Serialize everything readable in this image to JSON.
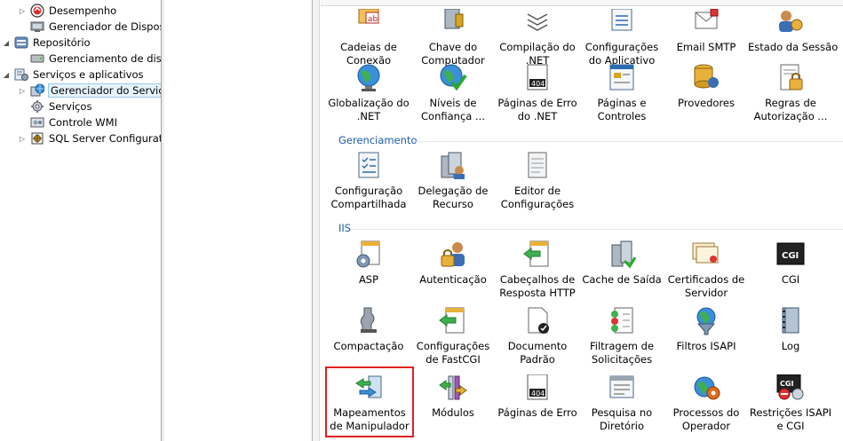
{
  "tree": {
    "items": [
      {
        "label": "Desempenho",
        "expander": "▷",
        "icon": "performance-icon"
      },
      {
        "label": "Gerenciador de Disposit",
        "expander": "",
        "icon": "device-manager-icon"
      },
      {
        "label": "Repositório",
        "expander": "◢",
        "icon": "storage-icon"
      },
      {
        "label": "Gerenciamento de disco",
        "expander": "",
        "icon": "disk-management-icon"
      },
      {
        "label": "Serviços e aplicativos",
        "expander": "◢",
        "icon": "services-apps-icon"
      },
      {
        "label": "Gerenciador do Serviços",
        "expander": "▷",
        "icon": "iis-manager-icon"
      },
      {
        "label": "Serviços",
        "expander": "",
        "icon": "services-icon"
      },
      {
        "label": "Controle WMI",
        "expander": "",
        "icon": "wmi-icon"
      },
      {
        "label": "SQL Server Configuratic",
        "expander": "▷",
        "icon": "sql-config-icon"
      }
    ]
  },
  "features": {
    "row1": [
      {
        "label1": "Cadeias de",
        "label2": "Conexão",
        "icon": "connection-strings-icon"
      },
      {
        "label1": "Chave do",
        "label2": "Computador",
        "icon": "machine-key-icon"
      },
      {
        "label1": "Compilação do",
        "label2": ".NET",
        "icon": "compilation-icon"
      },
      {
        "label1": "Configurações",
        "label2": "do Aplicativo",
        "icon": "app-settings-icon"
      },
      {
        "label1": "Email SMTP",
        "label2": "",
        "icon": "smtp-email-icon"
      },
      {
        "label1": "Estado da Sessão",
        "label2": "",
        "icon": "session-state-icon"
      }
    ],
    "row2": [
      {
        "label1": "Globalização do",
        "label2": ".NET",
        "icon": "globalization-icon"
      },
      {
        "label1": "Níveis de",
        "label2": "Confiança ...",
        "icon": "trust-levels-icon"
      },
      {
        "label1": "Páginas de Erro",
        "label2": "do .NET",
        "icon": "error-pages-net-icon"
      },
      {
        "label1": "Páginas e",
        "label2": "Controles",
        "icon": "pages-controls-icon"
      },
      {
        "label1": "Provedores",
        "label2": "",
        "icon": "providers-icon"
      },
      {
        "label1": "Regras de",
        "label2": "Autorização ...",
        "icon": "authorization-rules-icon"
      }
    ]
  },
  "groups": {
    "management": {
      "title": "Gerenciamento",
      "items": [
        {
          "label1": "Configuração",
          "label2": "Compartilhada",
          "icon": "shared-config-icon"
        },
        {
          "label1": "Delegação de",
          "label2": "Recurso",
          "icon": "feature-delegation-icon"
        },
        {
          "label1": "Editor de",
          "label2": "Configurações",
          "icon": "config-editor-icon"
        }
      ]
    },
    "iis": {
      "title": "IIS",
      "row1": [
        {
          "label1": "ASP",
          "label2": "",
          "icon": "asp-icon"
        },
        {
          "label1": "Autenticação",
          "label2": "",
          "icon": "authentication-icon"
        },
        {
          "label1": "Cabeçalhos de",
          "label2": "Resposta HTTP",
          "icon": "http-headers-icon"
        },
        {
          "label1": "Cache de Saída",
          "label2": "",
          "icon": "output-cache-icon"
        },
        {
          "label1": "Certificados de",
          "label2": "Servidor",
          "icon": "server-certificates-icon"
        },
        {
          "label1": "CGI",
          "label2": "",
          "icon": "cgi-icon"
        }
      ],
      "row2": [
        {
          "label1": "Compactação",
          "label2": "",
          "icon": "compression-icon"
        },
        {
          "label1": "Configurações",
          "label2": "de FastCGI",
          "icon": "fastcgi-icon"
        },
        {
          "label1": "Documento",
          "label2": "Padrão",
          "icon": "default-document-icon"
        },
        {
          "label1": "Filtragem de",
          "label2": "Solicitações",
          "icon": "request-filtering-icon"
        },
        {
          "label1": "Filtros ISAPI",
          "label2": "",
          "icon": "isapi-filters-icon"
        },
        {
          "label1": "Log",
          "label2": "",
          "icon": "logging-icon"
        }
      ],
      "row3": [
        {
          "label1": "Mapeamentos",
          "label2": "de Manipulador",
          "icon": "handler-mappings-icon"
        },
        {
          "label1": "Módulos",
          "label2": "",
          "icon": "modules-icon"
        },
        {
          "label1": "Páginas de Erro",
          "label2": "",
          "icon": "error-pages-icon"
        },
        {
          "label1": "Pesquisa no",
          "label2": "Diretório",
          "icon": "directory-browsing-icon"
        },
        {
          "label1": "Processos do",
          "label2": "Operador",
          "icon": "worker-processes-icon"
        },
        {
          "label1": "Restrições ISAPI",
          "label2": "e CGI",
          "icon": "isapi-cgi-restrictions-icon"
        }
      ]
    }
  },
  "icon_text": {
    "error_code": "404",
    "cgi": "CGI",
    "ab": "ab"
  },
  "colors": {
    "group_header": "#1e5aa8",
    "highlight": "#e02020",
    "selection": "#e5f3fb"
  }
}
